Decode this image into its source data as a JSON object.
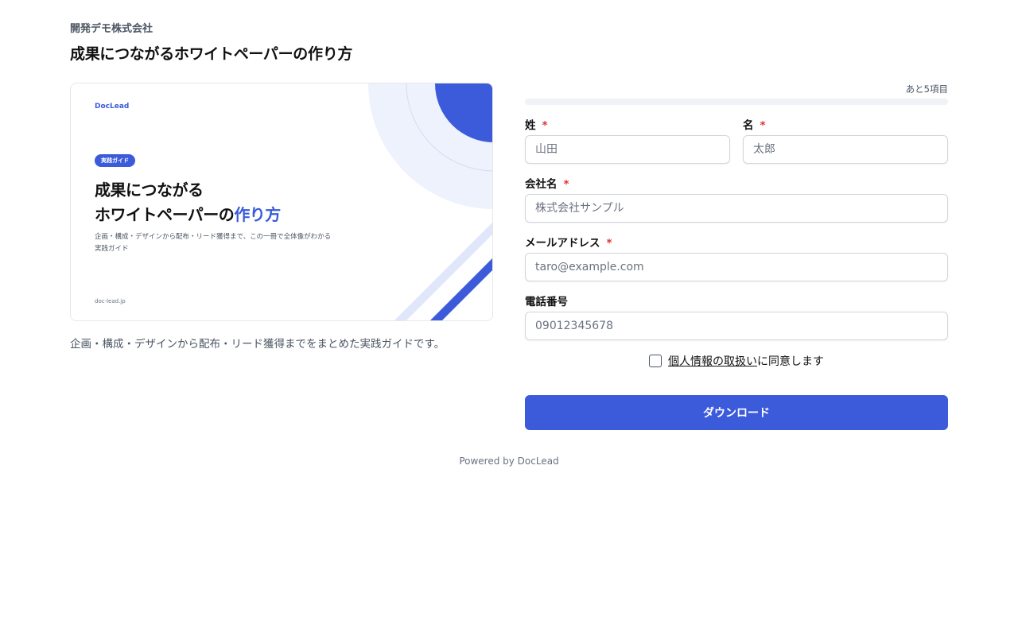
{
  "header": {
    "company": "開発デモ株式会社",
    "title": "成果につながるホワイトペーパーの作り方"
  },
  "cover": {
    "logo": "DocLead",
    "badge": "実践ガイド",
    "headline_line1": "成果につながる",
    "headline_line2_prefix": "ホワイトペーパーの",
    "headline_line2_accent": "作り方",
    "description": "企画・構成・デザインから配布・リード獲得まで、この一冊で全体像がわかる実践ガイド",
    "domain": "doc-lead.jp",
    "accent_color": "#3b5bdb"
  },
  "cover_caption": "企画・構成・デザインから配布・リード獲得までをまとめた実践ガイドです。",
  "form": {
    "remaining": "あと5項目",
    "progress_fraction": 0,
    "required_mark": "*",
    "last_name": {
      "label": "姓",
      "placeholder": "山田"
    },
    "first_name": {
      "label": "名",
      "placeholder": "太郎"
    },
    "company": {
      "label": "会社名",
      "placeholder": "株式会社サンプル"
    },
    "email": {
      "label": "メールアドレス",
      "placeholder": "taro@example.com"
    },
    "phone": {
      "label": "電話番号",
      "placeholder": "09012345678"
    },
    "consent_link": "個人情報の取扱い",
    "consent_text": "に同意します",
    "submit_label": "ダウンロード"
  },
  "footer": "Powered by DocLead"
}
